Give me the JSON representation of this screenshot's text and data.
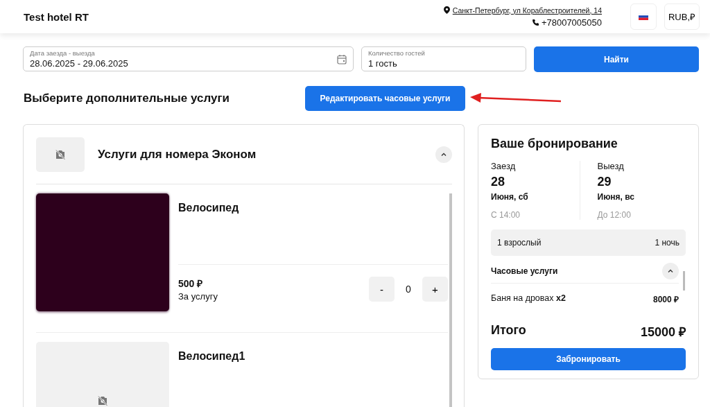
{
  "header": {
    "hotel_name": "Test hotel RT",
    "address": "Санкт-Петербург, ул Кораблестроителей, 14",
    "phone": "+78007005050",
    "currency": "RUB,₽"
  },
  "search": {
    "dates": {
      "label": "Дата заезда - выезда",
      "value": "28.06.2025 - 29.06.2025"
    },
    "guests": {
      "label": "Количество гостей",
      "value": "1 гость"
    },
    "button": "Найти"
  },
  "section": {
    "title": "Выберите дополнительные услуги",
    "edit_button": "Редактировать часовые услуги"
  },
  "services_group": {
    "title": "Услуги для номера Эконом",
    "expanded": true,
    "items": [
      {
        "name": "Велосипед",
        "kind": "photo",
        "price": "500 ₽",
        "unit": "За услугу",
        "minus": "-",
        "quantity": "0",
        "plus": "+"
      },
      {
        "name": "Велосипед1",
        "kind": "placeholder"
      }
    ]
  },
  "booking": {
    "title": "Ваше бронирование",
    "checkin": {
      "label": "Заезд",
      "day": "28",
      "date": "Июня, сб",
      "time": "С 14:00"
    },
    "checkout": {
      "label": "Выезд",
      "day": "29",
      "date": "Июня, вс",
      "time": "До 12:00"
    },
    "guests": "1 взрослый",
    "nights": "1 ночь",
    "hourly": {
      "title": "Часовые услуги",
      "expanded": true,
      "items": [
        {
          "name": "Баня на дровах **x2**",
          "price": "8000 ₽"
        }
      ]
    },
    "total_label": "Итого",
    "total": "15000 ₽",
    "button": "Забронировать"
  }
}
